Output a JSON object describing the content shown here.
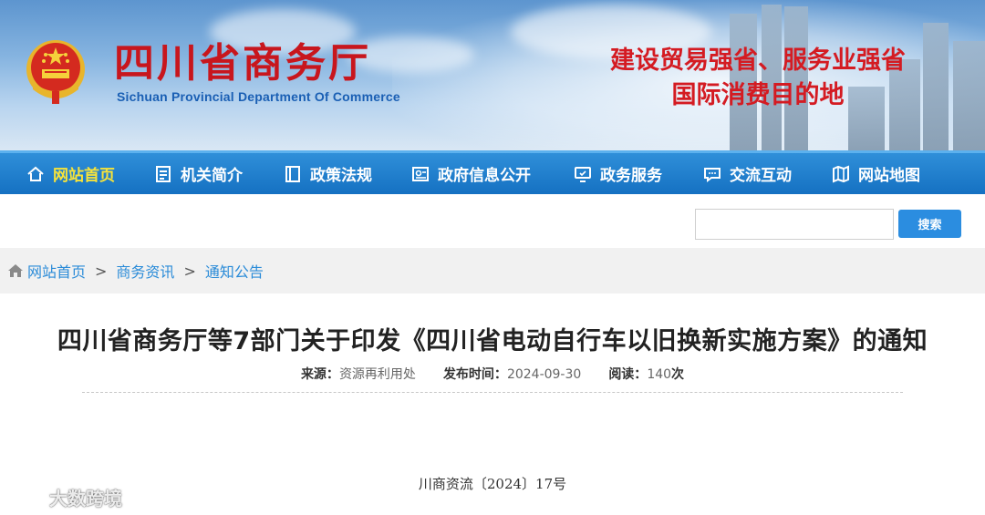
{
  "header": {
    "title_cn": "四川省商务厅",
    "title_en": "Sichuan Provincial Department Of Commerce",
    "slogan_line1": "建设贸易强省、服务业强省",
    "slogan_line2": "国际消费目的地"
  },
  "nav": {
    "items": [
      {
        "label": "网站首页",
        "icon": "home-icon",
        "active": true
      },
      {
        "label": "机关简介",
        "icon": "document-list-icon"
      },
      {
        "label": "政策法规",
        "icon": "book-icon"
      },
      {
        "label": "政府信息公开",
        "icon": "id-card-icon"
      },
      {
        "label": "政务服务",
        "icon": "monitor-icon"
      },
      {
        "label": "交流互动",
        "icon": "chat-bubble-icon"
      },
      {
        "label": "网站地图",
        "icon": "map-icon"
      }
    ]
  },
  "search": {
    "value": "",
    "button_label": "搜索"
  },
  "breadcrumb": {
    "items": [
      "网站首页",
      "商务资讯",
      "通知公告"
    ],
    "separator": ">"
  },
  "article": {
    "title": "四川省商务厅等7部门关于印发《四川省电动自行车以旧换新实施方案》的通知",
    "source_label": "来源：",
    "source_value": "资源再利用处",
    "date_label": "发布时间：",
    "date_value": "2024-09-30",
    "views_label": "阅读：",
    "views_value": "140",
    "views_unit": "次",
    "doc_number": "川商资流〔2024〕17号"
  },
  "watermark": {
    "text": "大数跨境"
  },
  "colors": {
    "nav_bg": "#1571c2",
    "nav_active": "#f7e33a",
    "title_red": "#c8161d",
    "link_blue": "#2a8bd8",
    "search_btn": "#2b8de0"
  }
}
